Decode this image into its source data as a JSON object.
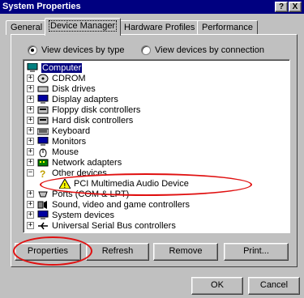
{
  "window": {
    "title": "System Properties",
    "help_label": "?",
    "close_label": "X"
  },
  "tabs": [
    {
      "label": "General"
    },
    {
      "label": "Device Manager"
    },
    {
      "label": "Hardware Profiles"
    },
    {
      "label": "Performance"
    }
  ],
  "view": {
    "by_type_label": "View devices by type",
    "by_connection_label": "View devices by connection",
    "selected": "by_type"
  },
  "tree": {
    "root": "Computer",
    "items": [
      {
        "label": "CDROM",
        "icon": "cdrom-icon"
      },
      {
        "label": "Disk drives",
        "icon": "disk-drive-icon"
      },
      {
        "label": "Display adapters",
        "icon": "display-adapter-icon"
      },
      {
        "label": "Floppy disk controllers",
        "icon": "floppy-controller-icon"
      },
      {
        "label": "Hard disk controllers",
        "icon": "hard-disk-controller-icon"
      },
      {
        "label": "Keyboard",
        "icon": "keyboard-icon"
      },
      {
        "label": "Monitors",
        "icon": "monitor-icon"
      },
      {
        "label": "Mouse",
        "icon": "mouse-icon"
      },
      {
        "label": "Network adapters",
        "icon": "network-adapter-icon"
      },
      {
        "label": "Other devices",
        "icon": "question-mark-icon"
      },
      {
        "label": "PCI Multimedia Audio Device",
        "icon": "warning-device-icon"
      },
      {
        "label": "Ports (COM & LPT)",
        "icon": "port-icon"
      },
      {
        "label": "Sound, video and game controllers",
        "icon": "sound-controller-icon"
      },
      {
        "label": "System devices",
        "icon": "system-device-icon"
      },
      {
        "label": "Universal Serial Bus controllers",
        "icon": "usb-icon"
      }
    ]
  },
  "buttons": {
    "properties": "Properties",
    "refresh": "Refresh",
    "remove": "Remove",
    "print": "Print...",
    "ok": "OK",
    "cancel": "Cancel"
  },
  "colors": {
    "titlebar": "#000080",
    "highlight": "#000080",
    "annotation": "#e01010",
    "face": "#c0c0c0"
  }
}
